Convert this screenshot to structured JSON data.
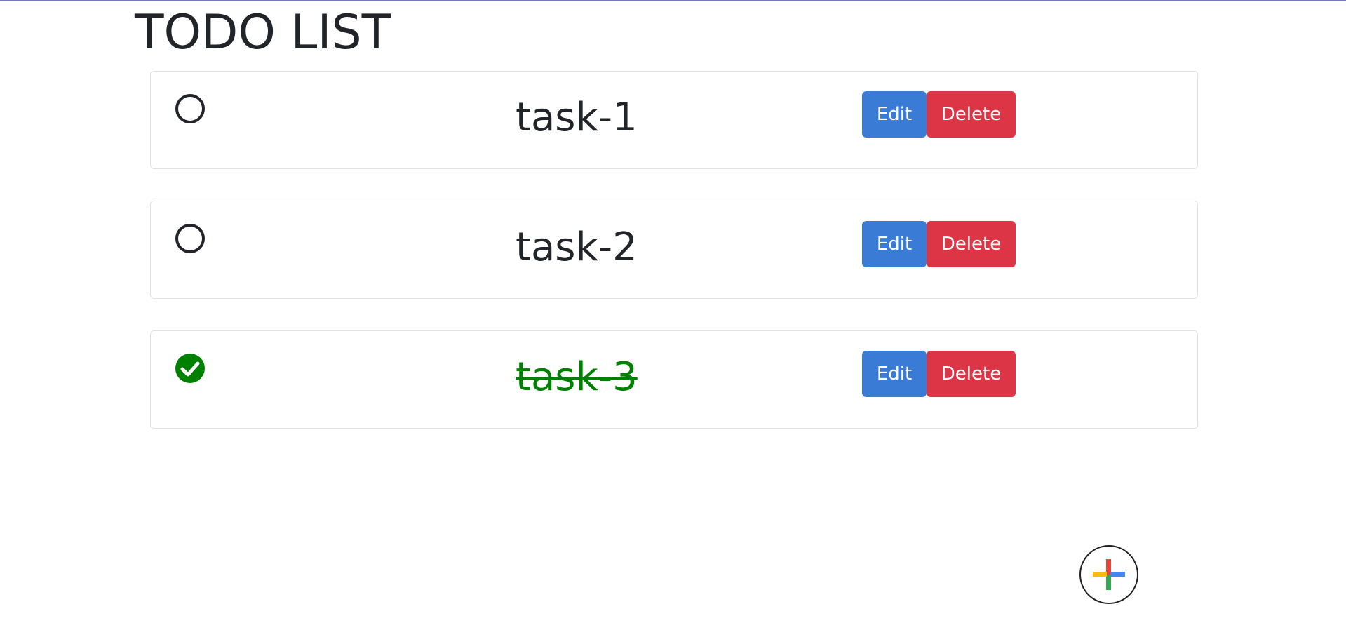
{
  "page": {
    "title": "TODO LIST"
  },
  "tasks": [
    {
      "name": "task-1",
      "done": false,
      "edit_label": "Edit",
      "delete_label": "Delete"
    },
    {
      "name": "task-2",
      "done": false,
      "edit_label": "Edit",
      "delete_label": "Delete"
    },
    {
      "name": "task-3",
      "done": true,
      "edit_label": "Edit",
      "delete_label": "Delete"
    }
  ],
  "add_button": {
    "icon": "plus-icon"
  },
  "colors": {
    "edit": "#3a7bd5",
    "delete": "#dc3545",
    "done": "#008000",
    "plus_red": "#ea4335",
    "plus_blue": "#4285f4",
    "plus_yellow": "#fbbc05",
    "plus_green": "#34a853"
  }
}
